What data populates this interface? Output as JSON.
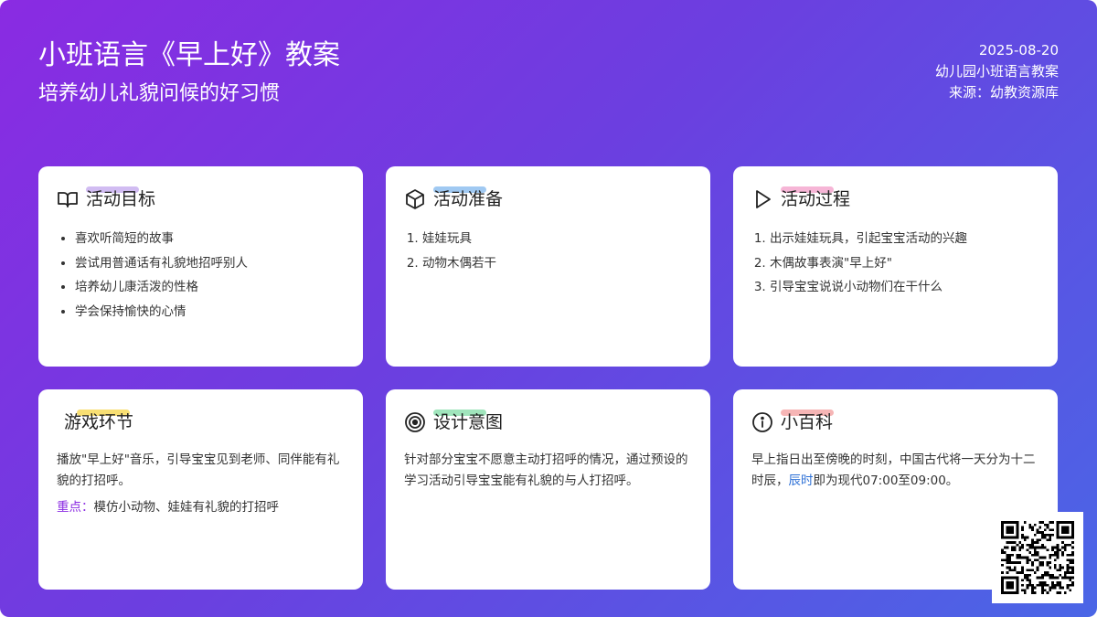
{
  "header": {
    "title": "小班语言《早上好》教案",
    "subtitle": "培养幼儿礼貌问候的好习惯",
    "date": "2025-08-20",
    "category": "幼儿园小班语言教案",
    "source": "来源：幼教资源库"
  },
  "cards": {
    "goals": {
      "icon": "book-icon",
      "title": "活动目标",
      "highlight_color": "#c9b0f0",
      "items": [
        "喜欢听简短的故事",
        "尝试用普通话有礼貌地招呼别人",
        "培养幼儿康活泼的性格",
        "学会保持愉快的心情"
      ]
    },
    "prep": {
      "icon": "cube-icon",
      "title": "活动准备",
      "highlight_color": "#8fc0f0",
      "items": [
        "娃娃玩具",
        "动物木偶若干"
      ]
    },
    "process": {
      "icon": "play-icon",
      "title": "活动过程",
      "highlight_color": "#f5a8cf",
      "items": [
        "出示娃娃玩具，引起宝宝活动的兴趣",
        "木偶故事表演\"早上好\"",
        "引导宝宝说说小动物们在干什么"
      ]
    },
    "game": {
      "title": "游戏环节",
      "highlight_color": "#f7d95a",
      "text": "播放\"早上好\"音乐，引导宝宝见到老师、同伴能有礼貌的打招呼。",
      "key_label": "重点：",
      "key_text": "模仿小动物、娃娃有礼貌的打招呼"
    },
    "design": {
      "icon": "target-icon",
      "title": "设计意图",
      "highlight_color": "#8fe0b0",
      "text": "针对部分宝宝不愿意主动打招呼的情况，通过预设的学习活动引导宝宝能有礼貌的与人打招呼。"
    },
    "trivia": {
      "icon": "info-icon",
      "title": "小百科",
      "highlight_color": "#f5a8a8",
      "text_before": "早上指日出至傍晚的时刻，中国古代将一天分为十二时辰，",
      "text_accent": "辰时",
      "text_after": "即为现代07:00至09:00。"
    }
  },
  "qr": {
    "icon": "qr-code-icon"
  }
}
